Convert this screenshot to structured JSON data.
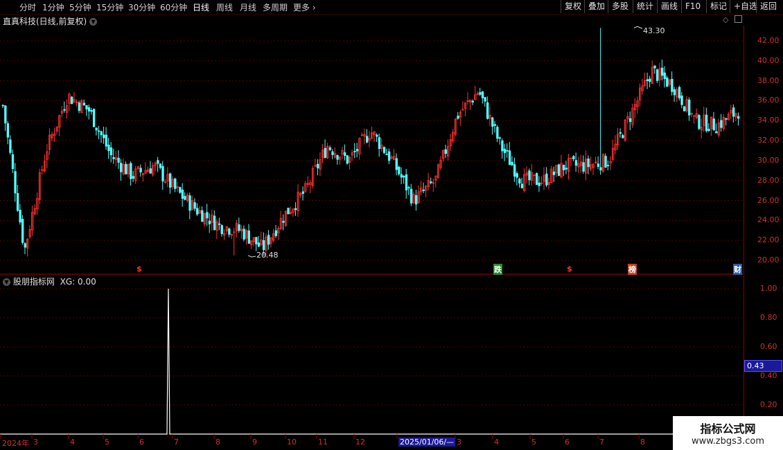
{
  "toolbar": {
    "periods": [
      "分时",
      "1分钟",
      "5分钟",
      "15分钟",
      "30分钟",
      "60分钟",
      "日线",
      "周线",
      "月线",
      "多周期",
      "更多"
    ],
    "active_period": "日线",
    "right_buttons": [
      "复权",
      "叠加",
      "多股",
      "统计",
      "画线",
      "F10",
      "标记",
      "+自选",
      "返回"
    ]
  },
  "main_chart": {
    "title": "直真科技(日线,前复权)",
    "y_ticks": [
      "42.00",
      "40.00",
      "38.00",
      "36.00",
      "34.00",
      "32.00",
      "30.00",
      "28.00",
      "26.00",
      "24.00",
      "22.00",
      "20.00"
    ],
    "high_label": "43.30",
    "low_label": "20.48",
    "markers": [
      {
        "text": "$",
        "color": "#ff3030"
      },
      {
        "text": "跌",
        "color": "#ffffff",
        "bg": "#2a8a2a"
      },
      {
        "text": "$",
        "color": "#ff3030"
      },
      {
        "text": "榜",
        "color": "#ffffff",
        "bg": "#c04020"
      },
      {
        "text": "财",
        "color": "#ffffff",
        "bg": "#2a5aaa"
      }
    ]
  },
  "indicator": {
    "title": "股朋指标网",
    "value_label": "XG: 0.00",
    "y_ticks": [
      "1.00",
      "0.80",
      "0.60",
      "0.40",
      "0.20"
    ],
    "cursor_value": "0.43"
  },
  "x_axis": {
    "labels": [
      "2024年",
      "3",
      "4",
      "5",
      "6",
      "7",
      "8",
      "9",
      "10",
      "11",
      "12",
      "1",
      "2025/01/06/—",
      "3",
      "4",
      "5",
      "6",
      "7",
      "8"
    ]
  },
  "watermark": {
    "line1": "指标公式网",
    "line2": "www.zbgs3.com"
  },
  "colors": {
    "up": "#ff3232",
    "down": "#54ffff",
    "axis": "#8b0000",
    "grid": "#5a0000"
  },
  "chart_data": {
    "type": "candlestick",
    "symbol": "直真科技",
    "period": "日线",
    "adjust": "前复权",
    "close_path": [
      {
        "x": "2024年",
        "y": 35.5
      },
      {
        "x": "2024-01-mid",
        "y": 21.0
      },
      {
        "x": "2024-02",
        "y": 31.0
      },
      {
        "x": "2024-02-late",
        "y": 36.5
      },
      {
        "x": "3",
        "y": 35.0
      },
      {
        "x": "3-late",
        "y": 30.5
      },
      {
        "x": "4",
        "y": 28.5
      },
      {
        "x": "4-mid",
        "y": 29.5
      },
      {
        "x": "5",
        "y": 27.0
      },
      {
        "x": "6",
        "y": 25.0
      },
      {
        "x": "7",
        "y": 23.5
      },
      {
        "x": "8",
        "y": 23.0
      },
      {
        "x": "9",
        "y": 21.2
      },
      {
        "x": "9-late",
        "y": 24.5
      },
      {
        "x": "10",
        "y": 27.0
      },
      {
        "x": "10-mid",
        "y": 31.5
      },
      {
        "x": "11",
        "y": 30.0
      },
      {
        "x": "12",
        "y": 33.0
      },
      {
        "x": "12-late",
        "y": 30.0
      },
      {
        "x": "1",
        "y": 26.0
      },
      {
        "x": "2025/01/06/—",
        "y": 28.0
      },
      {
        "x": "2",
        "y": 34.5
      },
      {
        "x": "2-late",
        "y": 37.0
      },
      {
        "x": "3",
        "y": 31.5
      },
      {
        "x": "3-gap",
        "y": 28.0
      },
      {
        "x": "4",
        "y": 28.0
      },
      {
        "x": "5",
        "y": 29.5
      },
      {
        "x": "6",
        "y": 29.5
      },
      {
        "x": "7",
        "y": 30.0
      },
      {
        "x": "7-late",
        "y": 34.5
      },
      {
        "x": "8",
        "y": 39.0
      },
      {
        "x": "8-mid",
        "y": 37.5
      },
      {
        "x": "8-late",
        "y": 34.0
      },
      {
        "x": "9",
        "y": 33.5
      },
      {
        "x": "9-end",
        "y": 35.0
      }
    ],
    "extremes": {
      "high": 43.3,
      "low": 20.48
    },
    "ylim": [
      19.5,
      43.5
    ],
    "indicator_series": {
      "name": "XG",
      "spike_position": "6-late",
      "spike_value": 1.0,
      "ylim": [
        0,
        1.05
      ]
    }
  }
}
